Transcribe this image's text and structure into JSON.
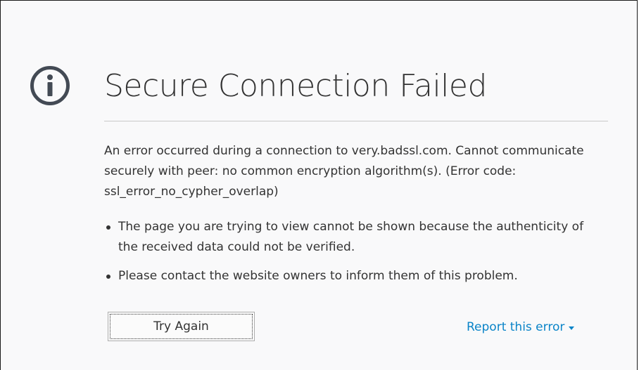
{
  "colors": {
    "background": "#f9f9fa",
    "text": "#333333",
    "icon": "#434a54",
    "link": "#0a84c8",
    "divider": "#c8c8c8"
  },
  "error_page": {
    "icon": "info-circle-icon",
    "title": "Secure Connection Failed",
    "description": "An error occurred during a connection to very.badssl.com. Cannot communicate securely with peer: no common encryption algorithm(s). (Error code: ssl_error_no_cypher_overlap)",
    "bullets": [
      "The page you are trying to view cannot be shown because the authenticity of the received data could not be verified.",
      "Please contact the website owners to inform them of this problem."
    ],
    "try_again_label": "Try Again",
    "report_label": "Report this error"
  }
}
